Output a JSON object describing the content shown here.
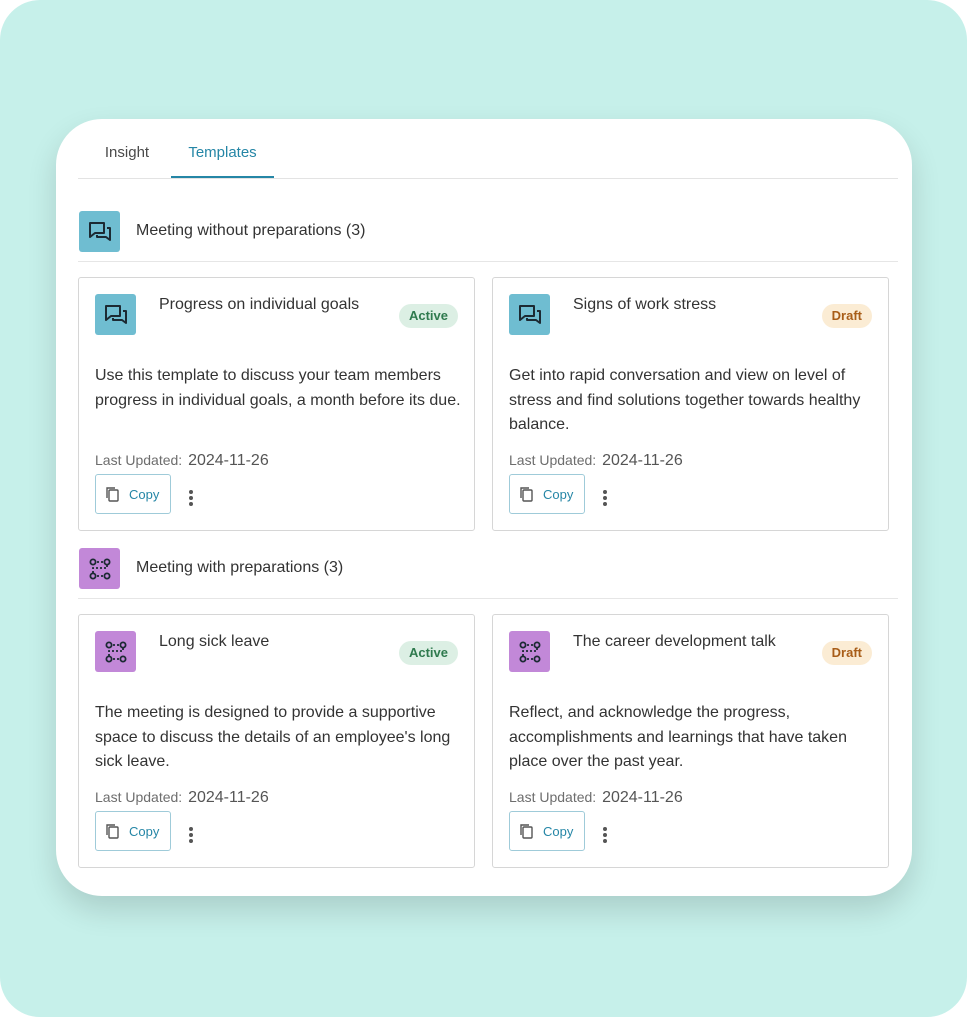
{
  "colors": {
    "background": "#c6f0ea",
    "accent": "#2586a6",
    "chat_icon_bg": "#6fbdd1",
    "flow_icon_bg": "#c288d8",
    "active_bg": "#dcefe4",
    "draft_bg": "#fbecd4"
  },
  "tabs": [
    {
      "label": "Insight",
      "selected": false
    },
    {
      "label": "Templates",
      "selected": true
    }
  ],
  "sections": [
    {
      "title": "Meeting without preparations (3)",
      "icon": "chat-bubbles-icon",
      "cards": [
        {
          "title": "Progress on individual goals",
          "status": "Active",
          "description": "Use this template to discuss your team members progress in individual goals, a month before its due.",
          "updated_label": "Last Updated:",
          "updated_date": "2024-11-26",
          "copy_label": "Copy"
        },
        {
          "title": "Signs of work stress",
          "status": "Draft",
          "description": "Get into rapid conversation and view on level of stress and find solutions together towards healthy balance.",
          "updated_label": "Last Updated:",
          "updated_date": "2024-11-26",
          "copy_label": "Copy"
        }
      ]
    },
    {
      "title": "Meeting with preparations (3)",
      "icon": "flow-icon",
      "cards": [
        {
          "title": "Long sick leave",
          "status": "Active",
          "description": "The meeting is designed to provide a supportive space to discuss the details of an employee's long sick leave.",
          "updated_label": "Last Updated:",
          "updated_date": "2024-11-26",
          "copy_label": "Copy"
        },
        {
          "title": "The career development talk",
          "status": "Draft",
          "description": "Reflect, and acknowledge the progress, accomplishments and learnings that have taken place over the past year.",
          "updated_label": "Last Updated:",
          "updated_date": "2024-11-26",
          "copy_label": "Copy"
        }
      ]
    }
  ]
}
